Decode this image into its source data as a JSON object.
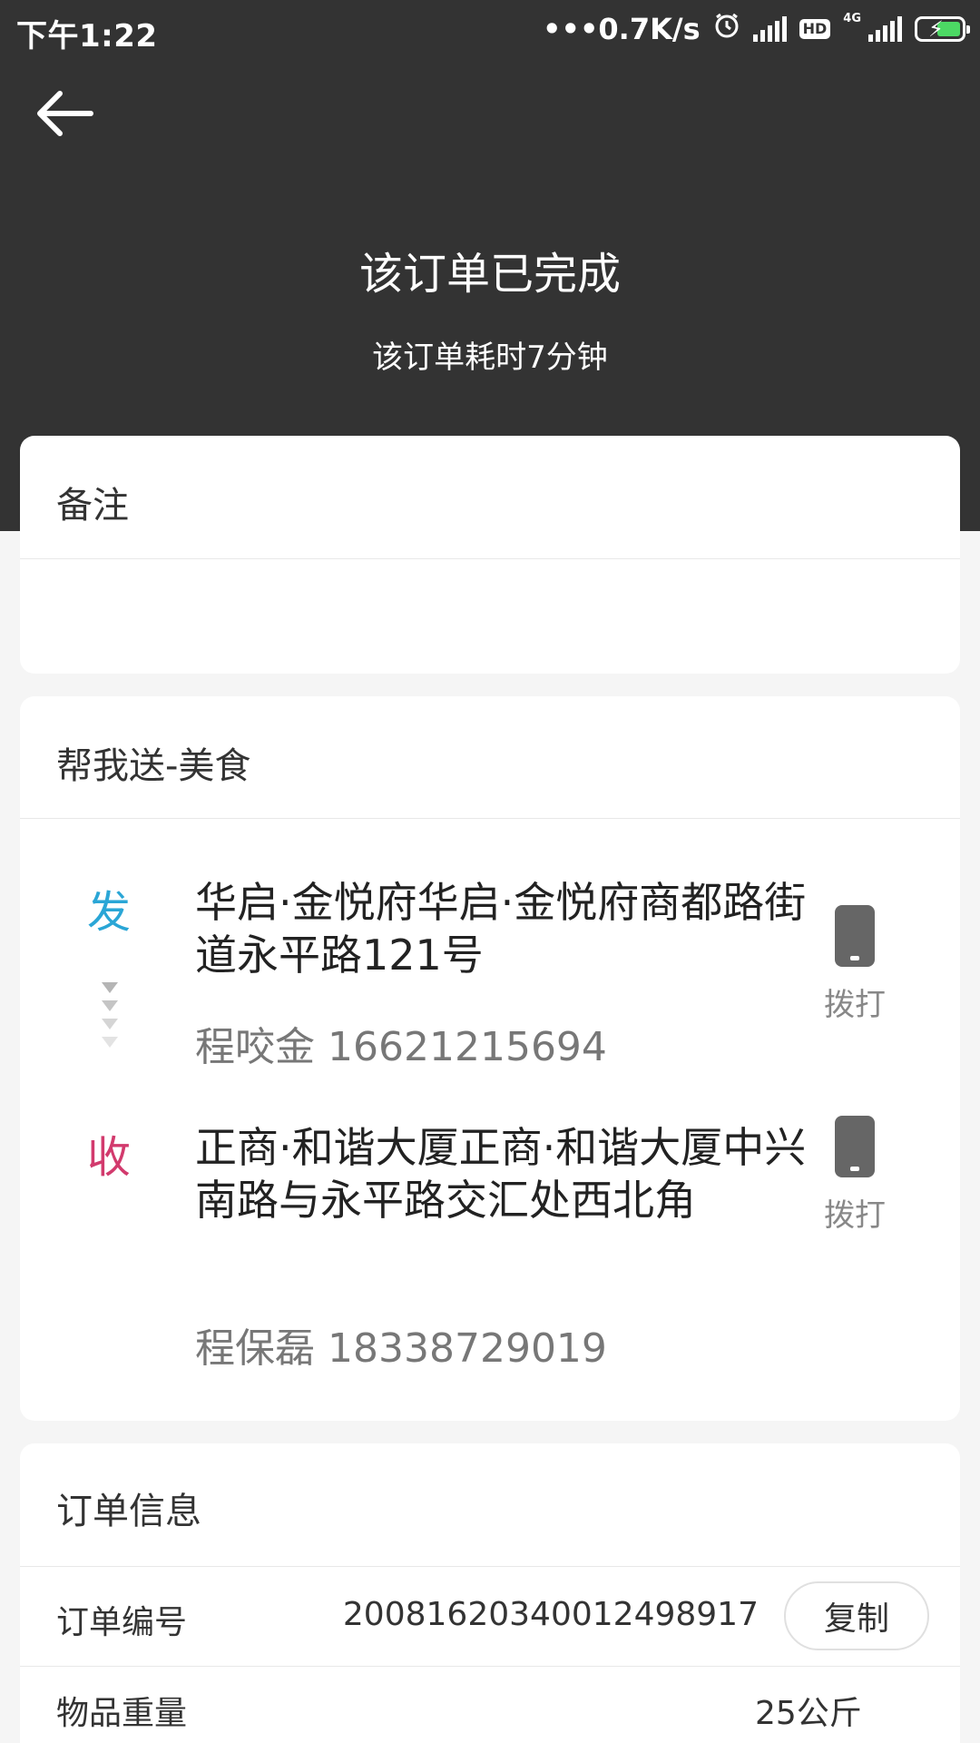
{
  "status_bar": {
    "time": "下午1:22",
    "speed": "0.7K/s",
    "hd": "HD",
    "network": "4G"
  },
  "header": {
    "title": "该订单已完成",
    "subtitle": "该订单耗时7分钟"
  },
  "remark": {
    "title": "备注",
    "content": ""
  },
  "route": {
    "title": "帮我送-美食",
    "sender": {
      "label": "发",
      "address": "华启·金悦府华启·金悦府商都路街道永平路121号",
      "contact": "程咬金 16621215694",
      "call_label": "拨打"
    },
    "receiver": {
      "label": "收",
      "address": "正商·和谐大厦正商·和谐大厦中兴南路与永平路交汇处西北角",
      "contact": "程保磊 18338729019",
      "call_label": "拨打"
    }
  },
  "order_info": {
    "title": "订单信息",
    "order_no_label": "订单编号",
    "order_no": "20081620340012498917",
    "copy_label": "复制",
    "weight_label": "物品重量",
    "weight": "25公斤"
  },
  "colors": {
    "header_bg": "#333333",
    "send_label": "#2aa6d6",
    "recv_label": "#d23a6d"
  }
}
